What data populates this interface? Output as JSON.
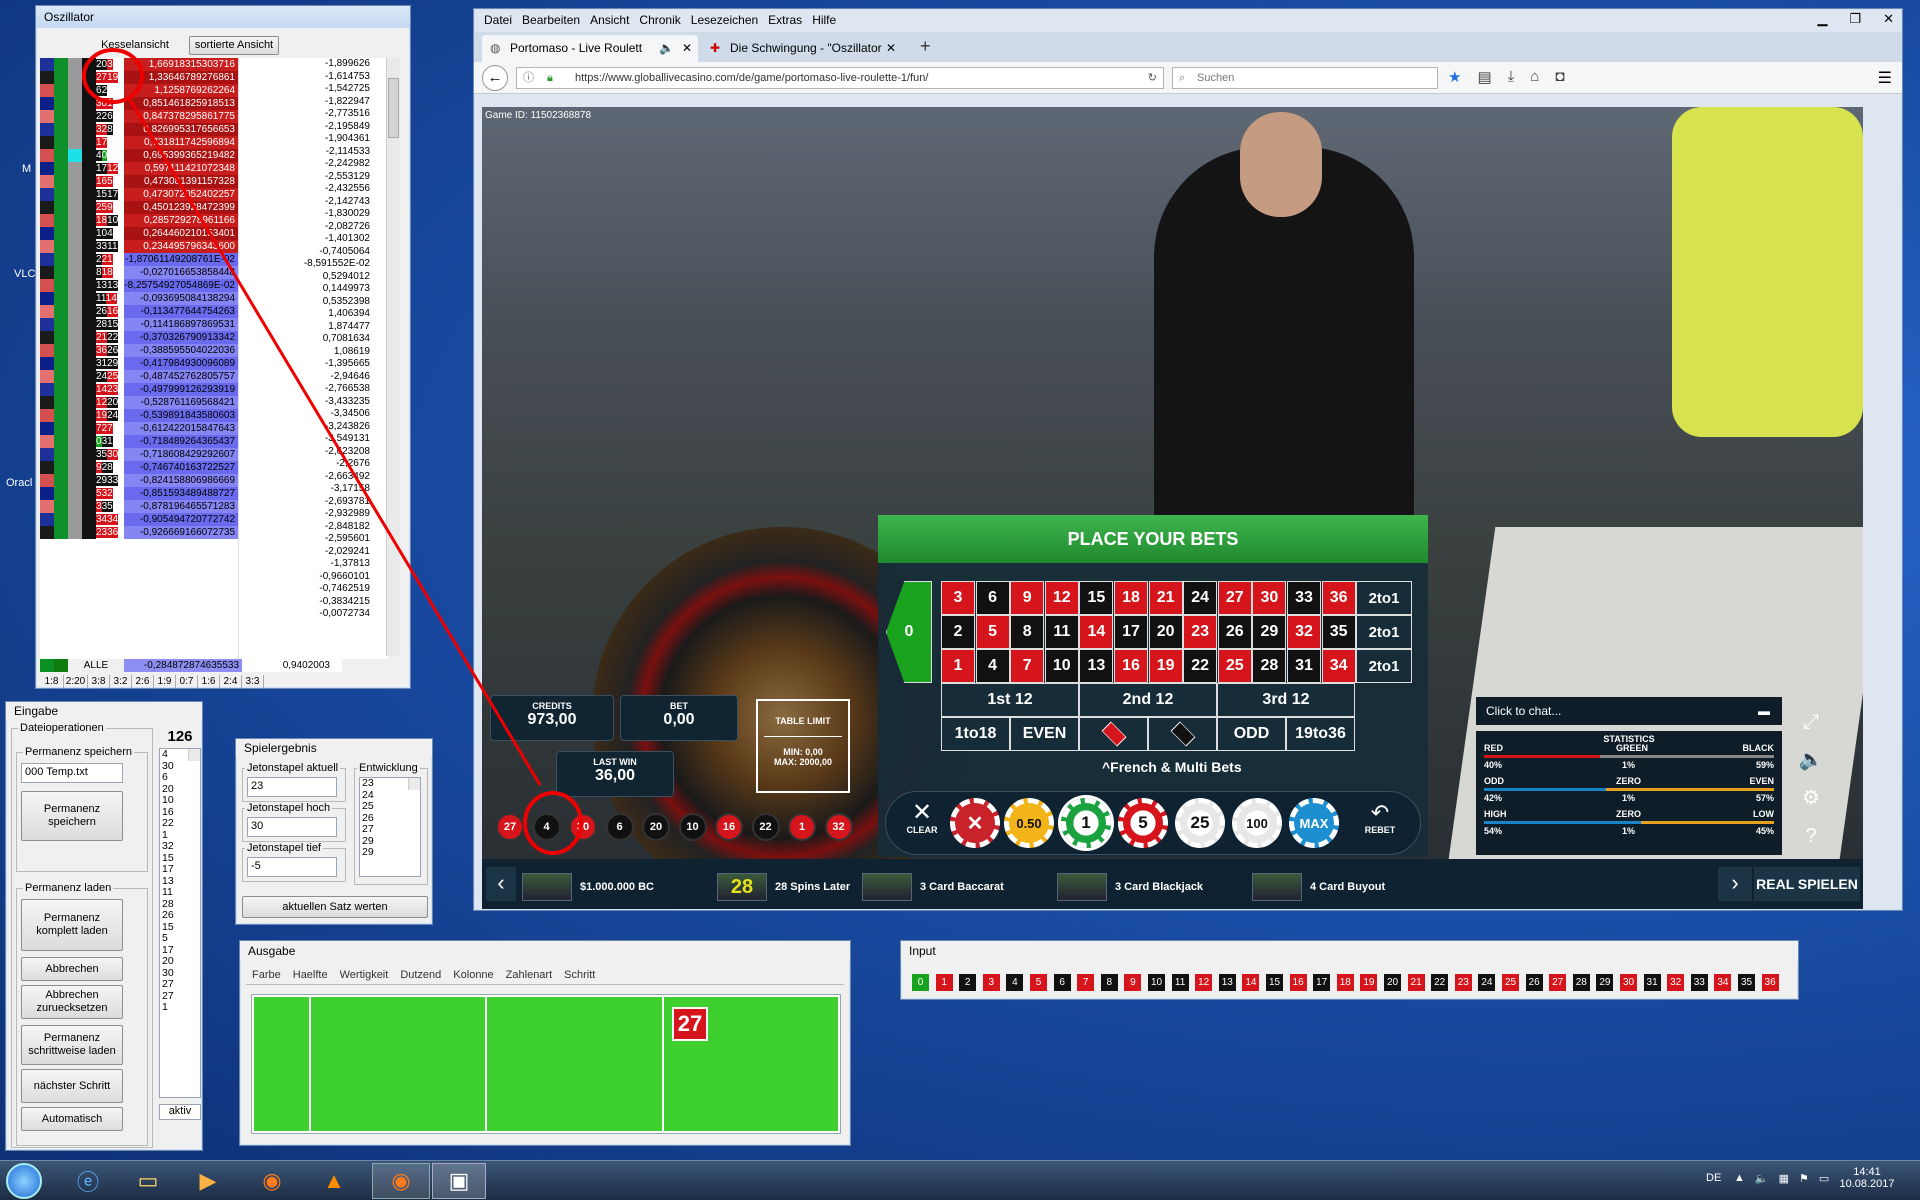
{
  "oszillator": {
    "title": "Oszillator",
    "btn_kessel": "Kesselansicht",
    "btn_sorted": "sortierte Ansicht",
    "rows": [
      {
        "a": "20",
        "b": "3",
        "v": "1,66918315303716",
        "f": "-1,899626"
      },
      {
        "a": "27",
        "b": "19",
        "v": "1,33646789276861",
        "f": "-1,614753"
      },
      {
        "a": "6",
        "b": "2",
        "v": "1,1258769262264",
        "f": "-1,542725"
      },
      {
        "a": "30",
        "b": "1",
        "v": "0,851461825918513",
        "f": "-1,822947"
      },
      {
        "a": "22",
        "b": "6",
        "v": "0,847378295861775",
        "f": "-2,773516"
      },
      {
        "a": "32",
        "b": "8",
        "v": "0,826995317656653",
        "f": "-2,195849"
      },
      {
        "a": "1",
        "b": "7",
        "v": "0,731811742596894",
        "f": "-1,904361"
      },
      {
        "a": "4",
        "b": "0",
        "v": "0,695399365219482",
        "f": "-2,114533"
      },
      {
        "a": "17",
        "b": "12",
        "v": "0,597111421072348",
        "f": "-2,242982"
      },
      {
        "a": "16",
        "b": "5",
        "v": "0,473081391157328",
        "f": "-2,553129"
      },
      {
        "a": "15",
        "b": "17",
        "v": "0,473072052402257",
        "f": "-2,432556"
      },
      {
        "a": "25",
        "b": "9",
        "v": "0,450123928472399",
        "f": "-2,142743"
      },
      {
        "a": "18",
        "b": "10",
        "v": "0,285729278961166",
        "f": "-1,830029"
      },
      {
        "a": "10",
        "b": "4",
        "v": "0,264460210153401",
        "f": "-2,082726"
      },
      {
        "a": "33",
        "b": "11",
        "v": "0,234495796343600",
        "f": "-1,401302"
      },
      {
        "a": "2",
        "b": "21",
        "v": "-1,87061149208761E-02",
        "f": "-0,7405064"
      },
      {
        "a": "8",
        "b": "18",
        "v": "-0,027016653858448",
        "f": "-8,591552E-02"
      },
      {
        "a": "13",
        "b": "13",
        "v": "-8,25754927054869E-02",
        "f": "0,5294012"
      },
      {
        "a": "11",
        "b": "14",
        "v": "-0,093695084138294",
        "f": "0,1449973"
      },
      {
        "a": "26",
        "b": "16",
        "v": "-0,113477644754263",
        "f": "0,5352398"
      },
      {
        "a": "28",
        "b": "15",
        "v": "-0,114186897869531",
        "f": "1,406394"
      },
      {
        "a": "21",
        "b": "22",
        "v": "-0,370326790913342",
        "f": "1,874477"
      },
      {
        "a": "36",
        "b": "26",
        "v": "-0,388595504022036",
        "f": "0,7081634"
      },
      {
        "a": "31",
        "b": "29",
        "v": "-0,417984930096089",
        "f": "1,08619"
      },
      {
        "a": "24",
        "b": "25",
        "v": "-0,487452762805757",
        "f": "-1,395665"
      },
      {
        "a": "14",
        "b": "23",
        "v": "-0,497999126293919",
        "f": "-2,94646"
      },
      {
        "a": "12",
        "b": "20",
        "v": "-0,528761169568421",
        "f": "-2,766538"
      },
      {
        "a": "19",
        "b": "24",
        "v": "-0,539891843580603",
        "f": "-3,433235"
      },
      {
        "a": "7",
        "b": "27",
        "v": "-0,612422015847643",
        "f": "-3,34506"
      },
      {
        "a": "0",
        "b": "31",
        "v": "-0,718489264365437",
        "f": "-3,243826"
      },
      {
        "a": "35",
        "b": "30",
        "v": "-0,718608429292607",
        "f": "-3,549131"
      },
      {
        "a": "9",
        "b": "28",
        "v": "-0,746740163722527",
        "f": "-2,623208"
      },
      {
        "a": "29",
        "b": "33",
        "v": "-0,824158806986669",
        "f": "-2,2676"
      },
      {
        "a": "5",
        "b": "32",
        "v": "-0,851593489488727",
        "f": "-2,663492"
      },
      {
        "a": "3",
        "b": "35",
        "v": "-0,878196465571283",
        "f": "-3,17158"
      },
      {
        "a": "34",
        "b": "34",
        "v": "-0,905494720772742",
        "f": "-2,693781"
      },
      {
        "a": "23",
        "b": "36",
        "v": "-0,926669166072735",
        "f": "-2,932989"
      }
    ],
    "extra_f": [
      "-2,848182",
      "-2,595601",
      "-2,029241",
      "-1,37813",
      "-0,9660101",
      "-0,7462519",
      "-0,3834215",
      "-0,0072734"
    ],
    "alle_label": "ALLE",
    "alle_value": "-0,284872874635533",
    "alle_f": "0,9402003",
    "ratios": [
      "1:8",
      "2:20",
      "3:8",
      "3:2",
      "2:6",
      "1:9",
      "0:7",
      "1:6",
      "2:4",
      "3:3"
    ]
  },
  "desktop_labels": {
    "m": "M",
    "vlc": "VLC",
    "oracle": "Oracl"
  },
  "eingabe": {
    "title": "Eingabe",
    "dateiop": "Dateioperationen",
    "perm_speichern": "Permanenz speichern",
    "file_value": "000 Temp.txt",
    "btn_speichern": "Permanenz speichern",
    "perm_laden": "Permanenz laden",
    "btn_komplett": "Permanenz komplett laden",
    "btn_abbrechen": "Abbrechen",
    "btn_abbrechen_reset": "Abbrechen zuruecksetzen",
    "btn_schrittweise": "Permanenz schrittweise laden",
    "btn_naechster": "nächster Schritt",
    "btn_auto": "Automatisch",
    "count": "126",
    "numbers": [
      "4",
      "30",
      "6",
      "20",
      "10",
      "16",
      "22",
      "1",
      "32",
      "15",
      "17",
      "13",
      "11",
      "28",
      "26",
      "15",
      "5",
      "17",
      "20",
      "30",
      "27",
      "27",
      "1"
    ],
    "status": "aktiv"
  },
  "spielergebnis": {
    "title": "Spielergebnis",
    "aktuell_label": "Jetonstapel aktuell",
    "aktuell_value": "23",
    "hoch_label": "Jetonstapel hoch",
    "hoch_value": "30",
    "tief_label": "Jetonstapel tief",
    "tief_value": "-5",
    "entw_label": "Entwicklung",
    "entw": [
      "23",
      "24",
      "25",
      "26",
      "27",
      "29",
      "29"
    ],
    "btn_werten": "aktuellen Satz werten"
  },
  "ausgabe": {
    "title": "Ausgabe",
    "tabs": [
      "Farbe",
      "Haelfte",
      "Wertigkeit",
      "Dutzend",
      "Kolonne",
      "Zahlenart",
      "Schritt"
    ],
    "value": "27"
  },
  "input": {
    "title": "Input",
    "numbers": [
      "0",
      "1",
      "2",
      "3",
      "4",
      "5",
      "6",
      "7",
      "8",
      "9",
      "10",
      "11",
      "12",
      "13",
      "14",
      "15",
      "16",
      "17",
      "18",
      "19",
      "20",
      "21",
      "22",
      "23",
      "24",
      "25",
      "26",
      "27",
      "28",
      "29",
      "30",
      "31",
      "32",
      "33",
      "34",
      "35",
      "36"
    ]
  },
  "browser": {
    "menu": [
      "Datei",
      "Bearbeiten",
      "Ansicht",
      "Chronik",
      "Lesezeichen",
      "Extras",
      "Hilfe"
    ],
    "tab1": "Portomaso - Live Roulett",
    "tab2": "Die Schwingung - \"Oszillator",
    "url": "https://www.globallivecasino.com/de/game/portomaso-live-roulette-1/fun/",
    "search_placeholder": "Suchen"
  },
  "game": {
    "game_id": "Game ID: 11502368878",
    "place_bets": "PLACE YOUR BETS",
    "zero": "0",
    "row1": [
      "3",
      "6",
      "9",
      "12",
      "15",
      "18",
      "21",
      "24",
      "27",
      "30",
      "33",
      "36"
    ],
    "row2": [
      "2",
      "5",
      "8",
      "11",
      "14",
      "17",
      "20",
      "23",
      "26",
      "29",
      "32",
      "35"
    ],
    "row3": [
      "1",
      "4",
      "7",
      "10",
      "13",
      "16",
      "19",
      "22",
      "25",
      "28",
      "31",
      "34"
    ],
    "col_label": "2to1",
    "d1": "1st 12",
    "d2": "2nd 12",
    "d3": "3rd 12",
    "b1": "1to18",
    "b2": "EVEN",
    "b3": "ODD",
    "b4": "19to36",
    "french": "^French & Multi Bets",
    "credits_label": "CREDITS",
    "credits_value": "973,00",
    "bet_label": "BET",
    "bet_value": "0,00",
    "lastwin_label": "LAST WIN",
    "lastwin_value": "36,00",
    "limit_label": "TABLE LIMIT",
    "limit_min": "MIN: 0,00",
    "limit_max": "MAX: 2000,00",
    "clear": "CLEAR",
    "rebet": "REBET",
    "chips": [
      "0.50",
      "1",
      "5",
      "25",
      "100",
      "MAX"
    ],
    "history": [
      "27",
      "4",
      "30",
      "6",
      "20",
      "10",
      "16",
      "22",
      "1",
      "32"
    ],
    "chat": "Click to chat...",
    "stats_title": "STATISTICS",
    "stats": [
      {
        "l": "RED",
        "m": "GREEN",
        "r": "BLACK",
        "lv": "40%",
        "mv": "1%",
        "rv": "59%",
        "lp": 40
      },
      {
        "l": "ODD",
        "m": "ZERO",
        "r": "EVEN",
        "lv": "42%",
        "mv": "1%",
        "rv": "57%",
        "lp": 42
      },
      {
        "l": "HIGH",
        "m": "ZERO",
        "r": "LOW",
        "lv": "54%",
        "mv": "1%",
        "rv": "45%",
        "lp": 54
      }
    ],
    "promos": [
      "$1.000.000 BC",
      "28 Spins Later",
      "3 Card Baccarat",
      "3 Card Blackjack",
      "4 Card Buyout"
    ],
    "promo_badge": "28",
    "real": "REAL SPIELEN"
  },
  "taskbar": {
    "lang": "DE",
    "time": "14:41",
    "date": "10.08.2017"
  }
}
